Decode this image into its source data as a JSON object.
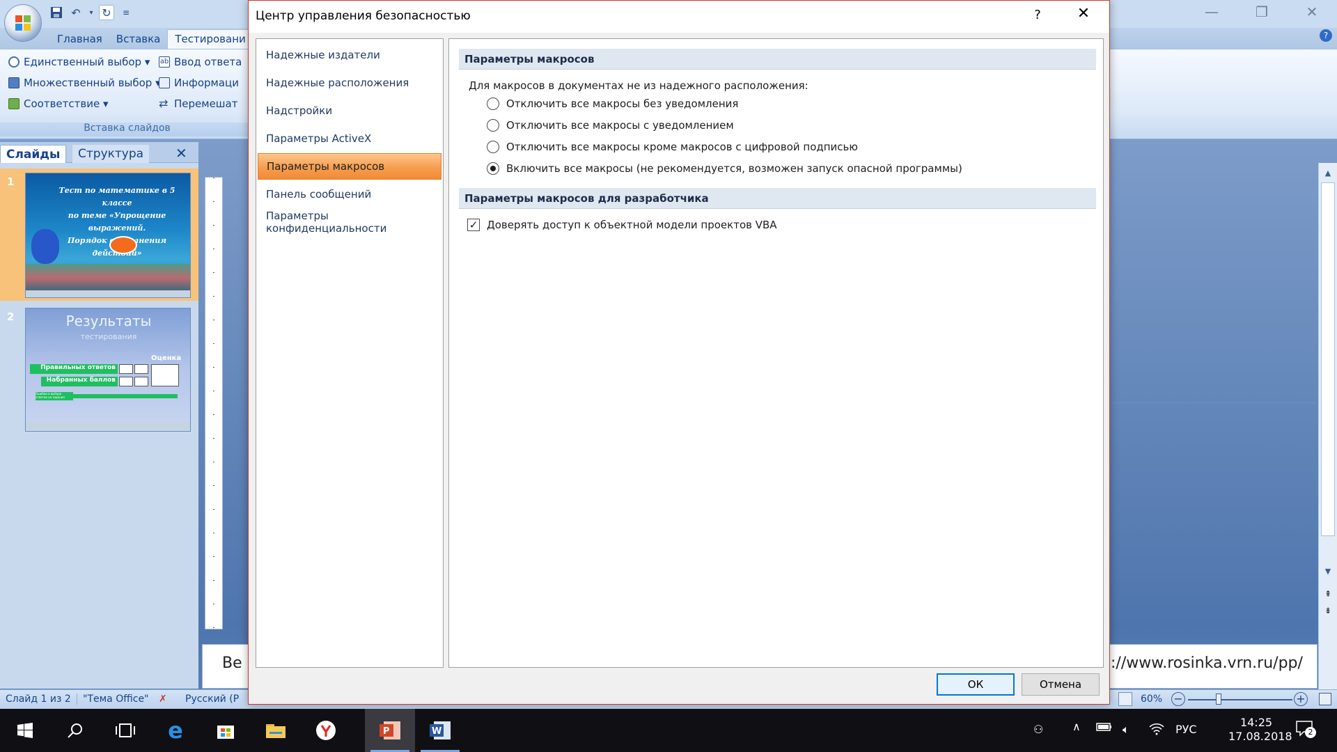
{
  "ppt": {
    "tabs": [
      "Главная",
      "Вставка",
      "Тестировани"
    ],
    "ribbon": {
      "items": [
        {
          "label": "Единственный выбор ▾"
        },
        {
          "label": "Множественный выбор ▾"
        },
        {
          "label": "Соответствие ▾"
        },
        {
          "label": "Ввод ответа"
        },
        {
          "label": "Информаци"
        },
        {
          "label": "Перемешат"
        }
      ],
      "group_label": "Вставка слайдов"
    },
    "slides_pane": {
      "tab_slides": "Слайды",
      "tab_outline": "Структура",
      "slides": [
        {
          "number": "1",
          "title_lines": [
            "Тест по математике в 5 классе",
            "по теме «Упрощение выражений.",
            "Порядок выполнения действий»"
          ]
        },
        {
          "number": "2",
          "title": "Результаты",
          "subtitle": "тестирования",
          "score_label": "Оценка",
          "correct_label": "Правильных ответов",
          "points_label": "Набранных баллов",
          "errors_label": "Ошибки в выборе ответов на задания"
        }
      ]
    },
    "notes_text_left": "Ве",
    "notes_text_right": "://www.rosinka.vrn.ru/pp/",
    "statusbar": {
      "slide_info": "Слайд 1 из 2",
      "theme": "\"Тема Office\"",
      "language": "Русский (Р",
      "zoom": "60%"
    }
  },
  "dialog": {
    "title": "Центр управления безопасностью",
    "help": "?",
    "close": "✕",
    "nav": [
      {
        "label": "Надежные издатели",
        "selected": false
      },
      {
        "label": "Надежные расположения",
        "selected": false
      },
      {
        "label": "Надстройки",
        "selected": false
      },
      {
        "label": "Параметры ActiveX",
        "selected": false
      },
      {
        "label": "Параметры макросов",
        "selected": true
      },
      {
        "label": "Панель сообщений",
        "selected": false
      },
      {
        "label": "Параметры конфиденциальности",
        "selected": false
      }
    ],
    "macro_section_title": "Параметры макросов",
    "macro_intro": "Для макросов в документах не из надежного расположения:",
    "macro_options": [
      {
        "label": "Отключить все макросы без уведомления",
        "checked": false
      },
      {
        "label": "Отключить все макросы с уведомлением",
        "checked": false
      },
      {
        "label": "Отключить все макросы кроме макросов с цифровой подписью",
        "checked": false
      },
      {
        "label": "Включить все макросы (не рекомендуется, возможен запуск опасной программы)",
        "checked": true
      }
    ],
    "dev_section_title": "Параметры макросов для разработчика",
    "dev_checkbox": {
      "label": "Доверять доступ к объектной модели проектов VBA",
      "checked": true
    },
    "ok": "ОК",
    "cancel": "Отмена"
  },
  "taskbar": {
    "apps": [
      "start-icon",
      "search-icon",
      "task-view-icon",
      "edge-icon",
      "store-icon",
      "file-explorer-icon",
      "yandex-browser-icon",
      "powerpoint-icon",
      "word-icon"
    ],
    "language": "РУС",
    "time": "14:25",
    "date": "17.08.2018",
    "notifications": "2"
  },
  "colors": {
    "dialog_border": "#c8382d",
    "selected_nav": "#f59e4f",
    "section_header": "#dfe7f1",
    "ribbon_text": "#15428b"
  }
}
